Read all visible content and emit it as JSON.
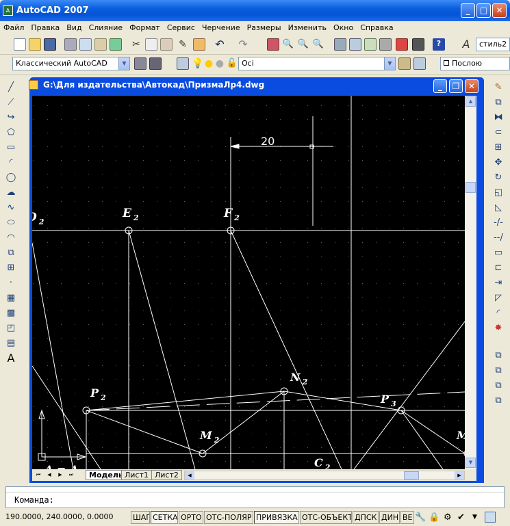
{
  "window": {
    "title": "AutoCAD 2007"
  },
  "menu": [
    "Файл",
    "Правка",
    "Вид",
    "Слияние",
    "Формат",
    "Сервис",
    "Черчение",
    "Размеры",
    "Изменить",
    "Окно",
    "Справка"
  ],
  "toolbar": {
    "style_combo": "стиль2",
    "workspace_combo": "Классический AutoCAD",
    "layer_combo": "Oci",
    "color_combo": "Послою"
  },
  "drawing": {
    "title": "G:\\Для издательства\\Автокад\\ПризмаЛр4.dwg",
    "dimension_text": "20",
    "labels": [
      {
        "base": "E",
        "sub": "2"
      },
      {
        "base": "F",
        "sub": "2"
      },
      {
        "base": "D",
        "sub": "2"
      },
      {
        "base": "N",
        "sub": "2"
      },
      {
        "base": "P",
        "sub": "2"
      },
      {
        "base": "P",
        "sub": "3"
      },
      {
        "base": "M",
        "sub": "2"
      },
      {
        "base": "C",
        "sub": "2"
      },
      {
        "base": "M",
        "sub": ""
      },
      {
        "base": "A = A",
        "sub": ""
      }
    ]
  },
  "tabs": [
    "Модель",
    "Лист1",
    "Лист2"
  ],
  "command": {
    "prompt": "Команда:"
  },
  "status": {
    "coords": "190.0000, 240.0000, 0.0000",
    "buttons": [
      "ШАГ",
      "СЕТКА",
      "ОРТО",
      "ОТС-ПОЛЯР",
      "ПРИВЯЗКА",
      "ОТС-ОБЪЕКТ",
      "ДПСК",
      "ДИН",
      "ВЕ"
    ]
  },
  "colors": {
    "title_blue": "#0a5fdc",
    "canvas": "#000000",
    "lines": "#ffffff"
  }
}
